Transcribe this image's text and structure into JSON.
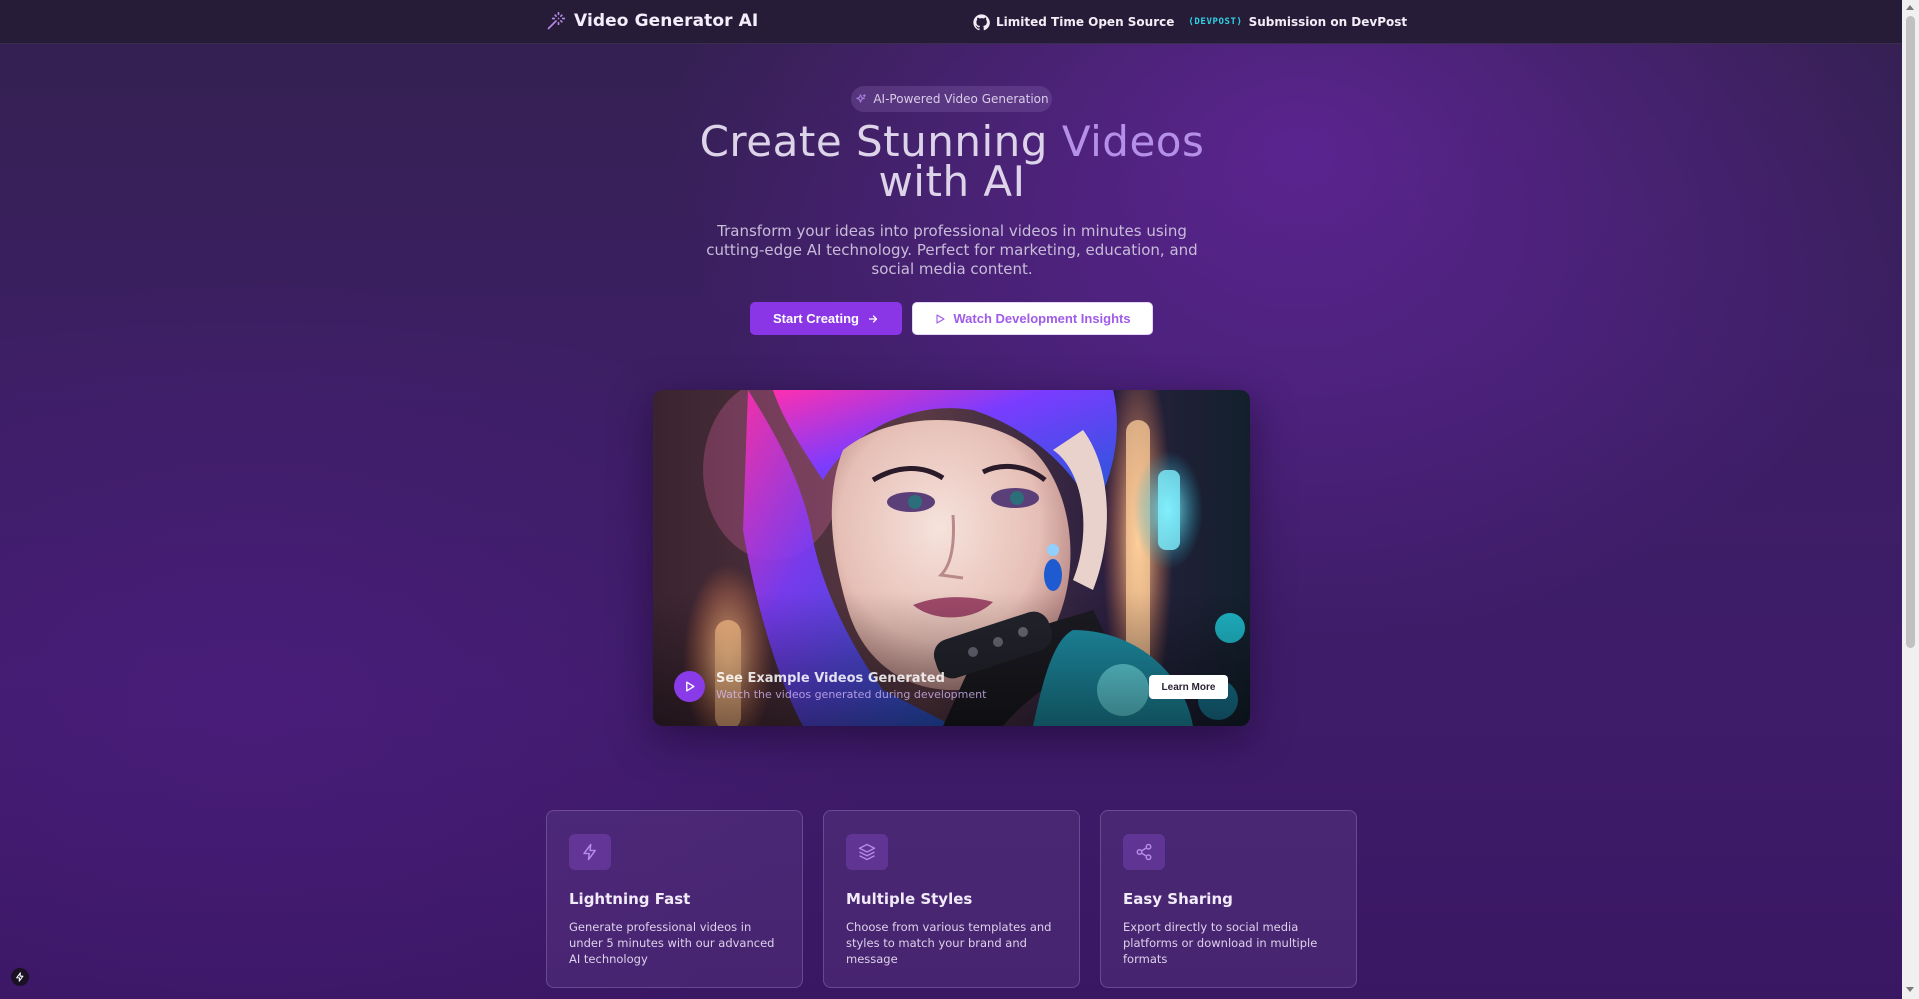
{
  "header": {
    "brand_icon": "magic-wand-icon",
    "title": "Video Generator AI",
    "links": {
      "open_source_icon": "github-icon",
      "open_source_label": "Limited Time Open Source",
      "devpost_badge": "⟨DEVPOST⟩",
      "devpost_label": "Submission on DevPost"
    }
  },
  "hero": {
    "pill_icon": "sparkles-icon",
    "pill_label": "AI-Powered Video Generation",
    "title_part1": "Create Stunning ",
    "title_accent": "Videos",
    "title_part2": "with AI",
    "subtitle": "Transform your ideas into professional videos in minutes using cutting-edge AI technology. Perfect for marketing, education, and social media content.",
    "primary_button": "Start Creating",
    "primary_button_icon": "arrow-right-icon",
    "secondary_button": "Watch Development Insights",
    "secondary_button_icon": "play-icon"
  },
  "video": {
    "caption_title": "See Example Videos Generated",
    "caption_subtitle": "Watch the videos generated during development",
    "play_icon": "play-icon",
    "learn_more": "Learn More"
  },
  "features": [
    {
      "icon": "lightning-icon",
      "title": "Lightning Fast",
      "description": "Generate professional videos in under 5 minutes with our advanced AI technology"
    },
    {
      "icon": "layers-icon",
      "title": "Multiple Styles",
      "description": "Choose from various templates and styles to match your brand and message"
    },
    {
      "icon": "share-icon",
      "title": "Easy Sharing",
      "description": "Export directly to social media platforms or download in multiple formats"
    }
  ],
  "colors": {
    "accent": "#8a35e6",
    "accent_text": "#b690e8",
    "header_bg": "#271c37"
  }
}
